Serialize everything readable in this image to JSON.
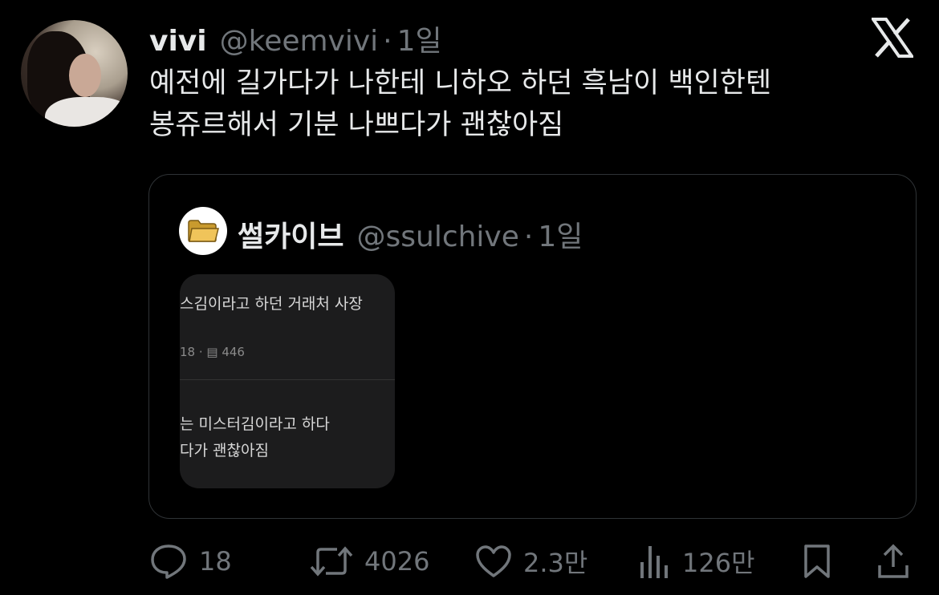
{
  "tweet": {
    "display_name": "vivi",
    "handle": "@keemvivi",
    "separator": "·",
    "time": "1일",
    "text_line1": "예전에 길가다가 나한테 니하오 하던 흑남이 백인한텐",
    "text_line2": "봉쥬르해서 기분 나쁘다가 괜찮아짐"
  },
  "quoted_tweet": {
    "display_name": "썰카이브",
    "handle": "@ssulchive",
    "separator": "·",
    "time": "1일",
    "avatar_icon": "folder-icon",
    "media": {
      "line1": "스김이라고 하던 거래처 사장",
      "meta": "18 · ▤ 446",
      "line2": "는 미스터김이라고 하다",
      "line3": "다가 괜찮아짐"
    }
  },
  "actions": {
    "reply_count": "18",
    "retweet_count": "4026",
    "like_count": "2.3만",
    "view_count": "126만"
  },
  "colors": {
    "background": "#000000",
    "text_primary": "#e7e9ea",
    "text_secondary": "#71767b",
    "border": "#2f3336"
  }
}
